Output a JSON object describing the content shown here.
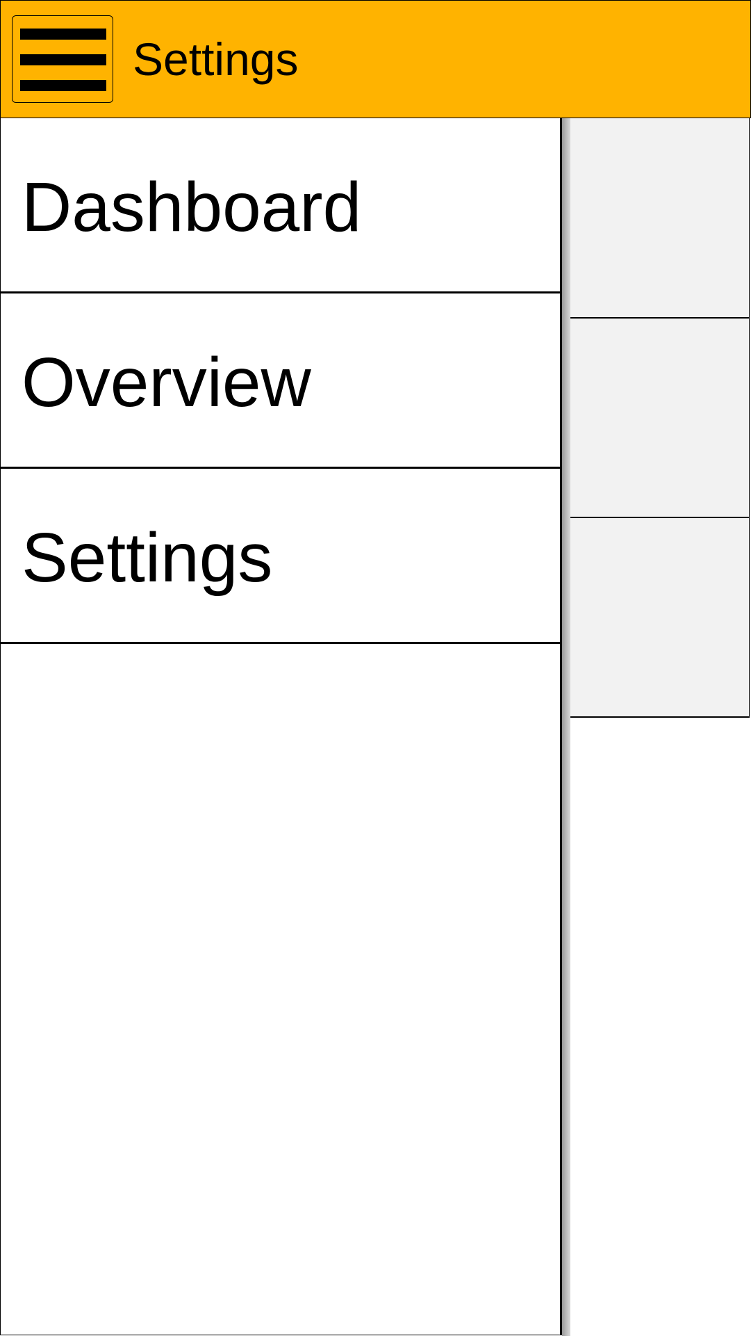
{
  "topbar": {
    "title": "Settings",
    "menu_icon": "hamburger-menu-icon",
    "background_color": "#FFB300"
  },
  "drawer": {
    "items": [
      {
        "label": "Dashboard"
      },
      {
        "label": "Overview"
      },
      {
        "label": "Settings"
      }
    ]
  },
  "content": {
    "row_background_color": "#F2F2F2"
  }
}
